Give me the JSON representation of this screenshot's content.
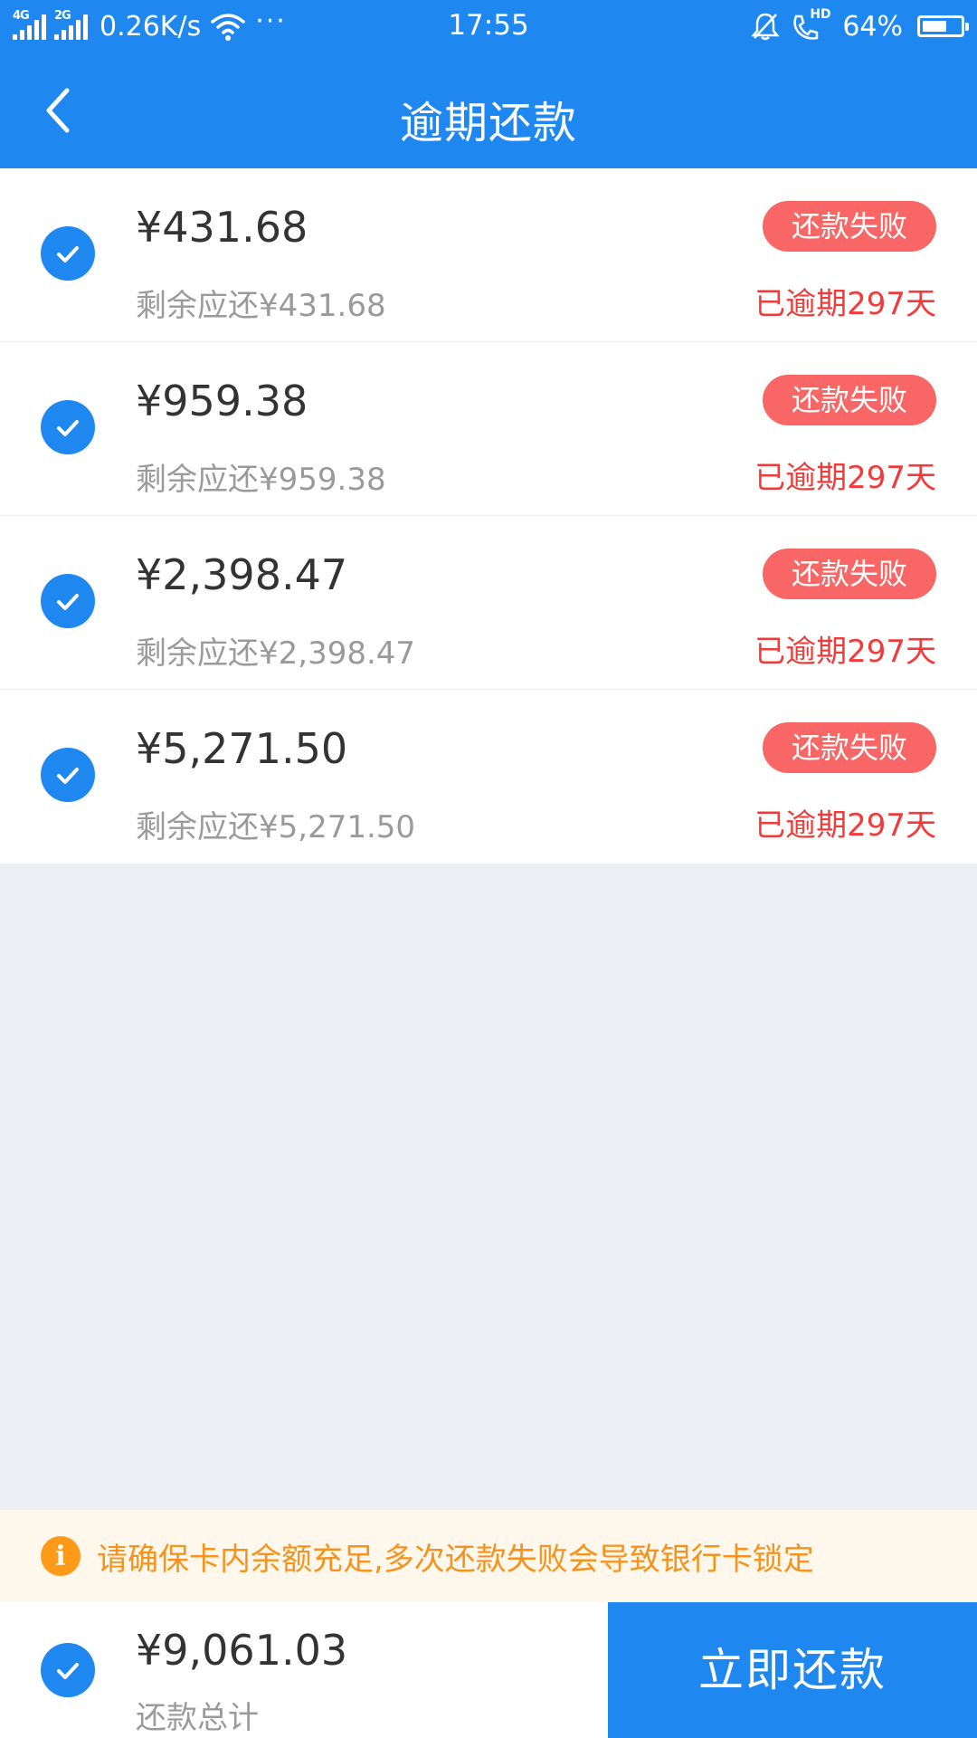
{
  "status_bar": {
    "net1": "4G",
    "net2": "2G",
    "speed": "0.26K/s",
    "dots": "···",
    "time": "17:55",
    "battery": "64%",
    "hd": "HD",
    "battery_level": 0.64
  },
  "header": {
    "title": "逾期还款"
  },
  "items": [
    {
      "amount": "¥431.68",
      "remaining": "剩余应还¥431.68",
      "status": "还款失败",
      "overdue": "已逾期297天"
    },
    {
      "amount": "¥959.38",
      "remaining": "剩余应还¥959.38",
      "status": "还款失败",
      "overdue": "已逾期297天"
    },
    {
      "amount": "¥2,398.47",
      "remaining": "剩余应还¥2,398.47",
      "status": "还款失败",
      "overdue": "已逾期297天"
    },
    {
      "amount": "¥5,271.50",
      "remaining": "剩余应还¥5,271.50",
      "status": "还款失败",
      "overdue": "已逾期297天"
    }
  ],
  "notice": {
    "icon": "i",
    "text": "请确保卡内余额充足,多次还款失败会导致银行卡锁定"
  },
  "footer": {
    "total_amount": "¥9,061.03",
    "total_label": "还款总计",
    "pay_button": "立即还款"
  },
  "colors": {
    "primary": "#1e88f0",
    "fail_badge": "#f86666",
    "overdue_text": "#f23a3a",
    "notice_bg": "#fef8ec",
    "notice_text": "#f6921e"
  }
}
